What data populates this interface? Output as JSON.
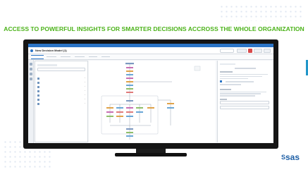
{
  "headline": "ACCESS TO POWERFUL INSIGHTS FOR SMARTER DECISIONS ACCROSS THE WHOLE ORGANIZATION",
  "logo": {
    "text": "sas",
    "mark": "S"
  },
  "caption": "",
  "app": {
    "window_title": "",
    "title": "New Decision Model (1)",
    "tabs": [
      "",
      "",
      "",
      "",
      "",
      ""
    ],
    "buttons": [
      "",
      "",
      ""
    ]
  },
  "nodes_panel": {
    "title": "",
    "search_placeholder": "",
    "items": [
      "",
      "",
      "",
      "",
      "",
      "",
      ""
    ]
  },
  "right_panel": {
    "title": "",
    "subtitle": "",
    "sections": [
      {
        "label": "",
        "text": ""
      },
      {
        "label": "",
        "text": ""
      }
    ]
  },
  "colors": {
    "headline": "#4cb31a",
    "brand_blue": "#2b74c6",
    "logo_blue": "#1e5fa6",
    "bezel": "#151515"
  }
}
